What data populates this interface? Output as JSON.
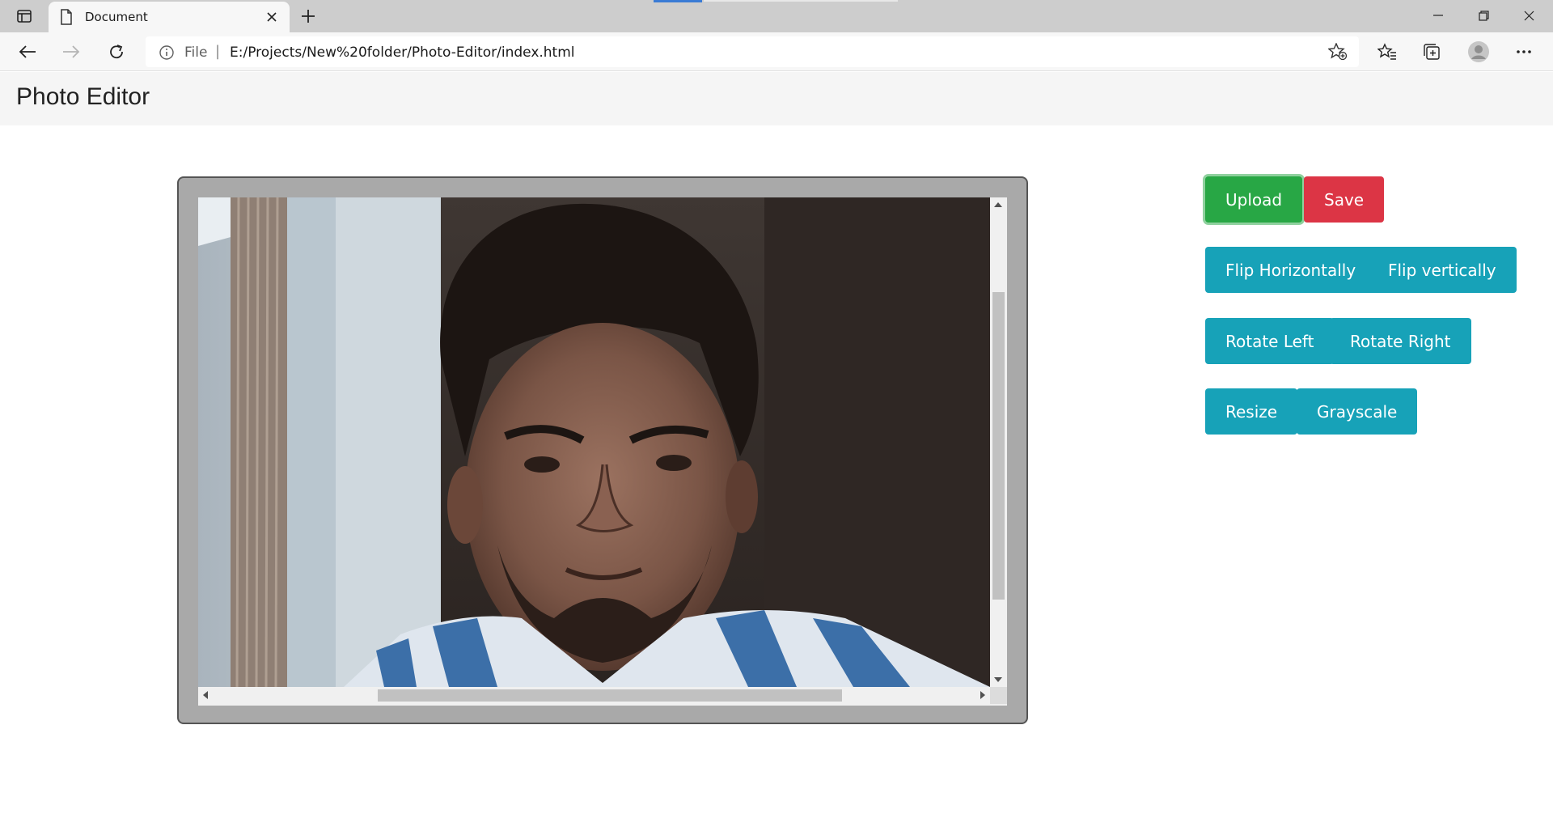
{
  "browser": {
    "tab_title": "Document",
    "address_scheme": "File",
    "address_separator": "|",
    "address_url": "E:/Projects/New%20folder/Photo-Editor/index.html"
  },
  "page": {
    "title": "Photo Editor"
  },
  "canvas": {
    "image_description_icon": "photo-of-person",
    "horizontal_scroll_position": 0.24,
    "vertical_scroll_position": 0.19
  },
  "controls": {
    "upload_label": "Upload",
    "save_label": "Save",
    "flip_h_label": "Flip Horizontally",
    "flip_v_label": "Flip vertically",
    "rotate_left_label": "Rotate Left",
    "rotate_right_label": "Rotate Right",
    "resize_label": "Resize",
    "grayscale_label": "Grayscale"
  },
  "colors": {
    "success": "#28a745",
    "danger": "#dc3545",
    "info": "#17a2b8"
  }
}
